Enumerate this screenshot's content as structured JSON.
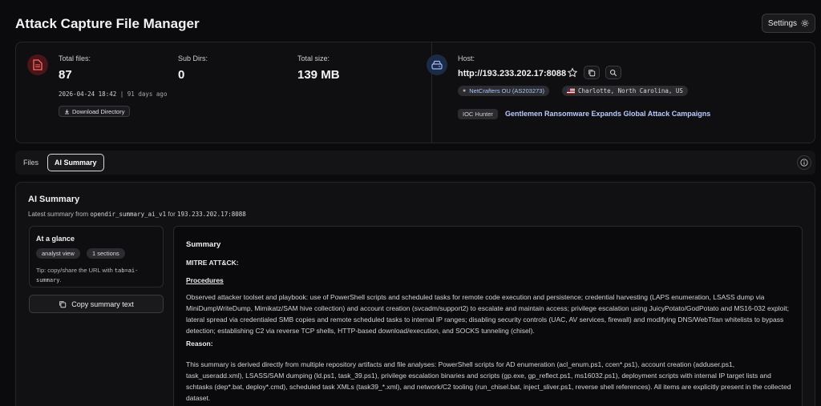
{
  "header": {
    "title": "Attack Capture File Manager",
    "settings_label": "Settings"
  },
  "stats": {
    "total_files_label": "Total files:",
    "total_files_value": "87",
    "sub_dirs_label": "Sub Dirs:",
    "sub_dirs_value": "0",
    "total_size_label": "Total size:",
    "total_size_value": "139 MB",
    "timestamp": "2026-04-24 18:42",
    "age": "| 91 days ago",
    "download_label": "Download Directory"
  },
  "host": {
    "label": "Host:",
    "value": "http://193.233.202.17:8088",
    "asn_name": "NetCrafters OU",
    "asn_code": "(AS203273)",
    "location": "Charlotte, North Carolina, US",
    "ioc_badge": "IOC Hunter",
    "ioc_link": "Gentlemen Ransomware Expands Global Attack Campaigns"
  },
  "tabs": [
    {
      "label": "Files",
      "active": false
    },
    {
      "label": "AI Summary",
      "active": true
    }
  ],
  "ai_summary": {
    "title": "AI Summary",
    "meta_prefix": "Latest summary from",
    "meta_source": "opendir_summary_ai_v1",
    "meta_for": "for",
    "meta_host": "193.233.202.17:8088",
    "glance": {
      "title": "At a glance",
      "chips": [
        "analyst view",
        "1 sections"
      ],
      "tip_prefix": "Tip: copy/share the URL with",
      "tip_param": "tab=ai-summary",
      "tip_suffix": "."
    },
    "copy_label": "Copy summary text",
    "content": {
      "heading": "Summary",
      "mitre": "MITRE ATT&CK:",
      "procedures": "Procedures",
      "procedures_text": "Observed attacker toolset and playbook: use of PowerShell scripts and scheduled tasks for remote code execution and persistence; credential harvesting (LAPS enumeration, LSASS dump via MiniDumpWriteDump, Mimikatz/SAM hive collection) and account creation (svcadm/support2) to escalate and maintain access; privilege escalation using JuicyPotato/GodPotato and MS16-032 exploit; lateral spread via credentialed SMB copies and remote scheduled tasks to internal IP ranges; disabling security controls (UAC, AV services, firewall) and modifying DNS/WebTitan whitelists to bypass detection; establishing C2 via reverse TCP shells, HTTP-based download/execution, and SOCKS tunneling (chisel).",
      "reason": "Reason:",
      "reason_text": "This summary is derived directly from multiple repository artifacts and file analyses: PowerShell scripts for AD enumeration (acl_enum.ps1, ccen*.ps1), account creation (adduser.ps1, task_useradd.xml), LSASS/SAM dumping (ld.ps1, task_39.ps1), privilege escalation binaries and scripts (gp.exe, gp_reflect.ps1, ms16032.ps1), deployment scripts with internal IP target lists and schtasks (dep*.bat, deploy*.cmd), scheduled task XMLs (task39_*.xml), and network/C2 tooling (run_chisel.bat, inject_sliver.ps1, reverse shell references). All items are explicitly present in the collected dataset."
    }
  }
}
